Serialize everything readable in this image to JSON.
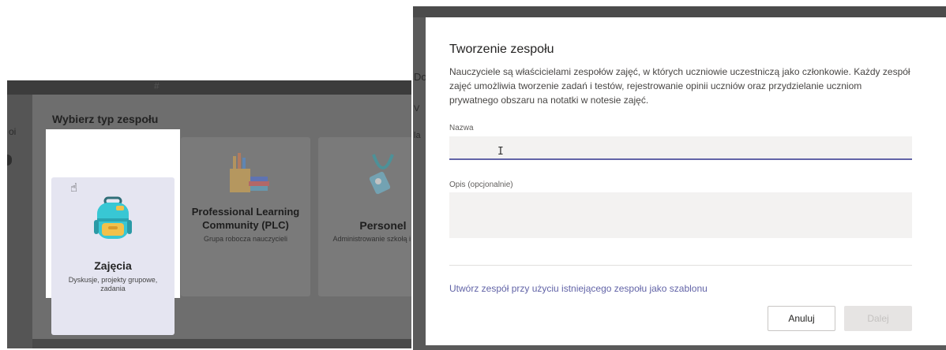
{
  "left_panel": {
    "top_icon": "#",
    "side_text": "oi",
    "dialog_title": "Wybierz typ zespołu",
    "cards": [
      {
        "title": "Zajęcia",
        "subtitle": "Dyskusje, projekty grupowe, zadania",
        "icon": "backpack-icon",
        "selected": true
      },
      {
        "title": "Professional Learning Community (PLC)",
        "subtitle": "Grupa robocza nauczycieli",
        "icon": "books-pencils-icon",
        "selected": false
      },
      {
        "title": "Personel",
        "subtitle": "Administrowanie szkołą i rozwój",
        "icon": "badge-lanyard-icon",
        "selected": false
      }
    ]
  },
  "right_panel": {
    "side_texts": [
      "Do",
      "V",
      "la"
    ],
    "dialog": {
      "title": "Tworzenie zespołu",
      "description": "Nauczyciele są właścicielami zespołów zajęć, w których uczniowie uczestniczą jako członkowie. Każdy zespół zajęć umożliwia tworzenie zadań i testów, rejestrowanie opinii uczniów oraz przydzielanie uczniom prywatnego obszaru na notatki w notesie zajęć.",
      "name_label": "Nazwa",
      "name_value": "",
      "description_label": "Opis (opcjonalnie)",
      "description_value": "",
      "template_link": "Utwórz zespół przy użyciu istniejącego zespołu jako szablonu",
      "cancel_label": "Anuluj",
      "next_label": "Dalej"
    }
  },
  "colors": {
    "accent": "#6264a7",
    "selected_card": "#e5e5f1",
    "input_bg": "#f3f2f1",
    "disabled_btn": "#e6e4e3"
  }
}
